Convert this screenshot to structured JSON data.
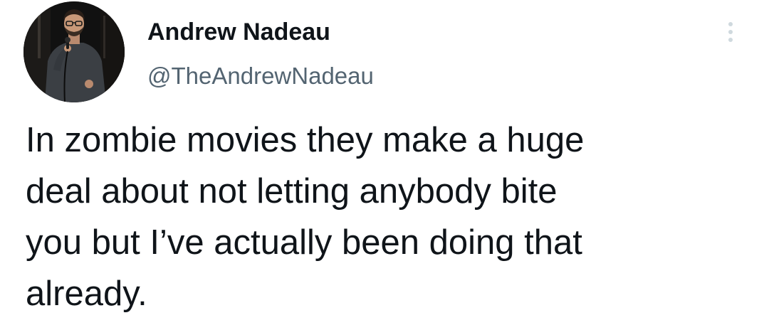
{
  "tweet": {
    "author": {
      "display_name": "Andrew Nadeau",
      "handle": "@TheAndrewNadeau",
      "avatar_icon": "profile-photo-avatar"
    },
    "more_icon": "vertical-ellipsis-icon",
    "text": "In zombie movies they make a huge\ndeal about not letting anybody bite\nyou but I’ve actually been doing that\nalready."
  },
  "colors": {
    "background": "#ffffff",
    "primary_text": "#0f1419",
    "secondary_text": "#536471",
    "more_icon": "#cfd9de"
  }
}
